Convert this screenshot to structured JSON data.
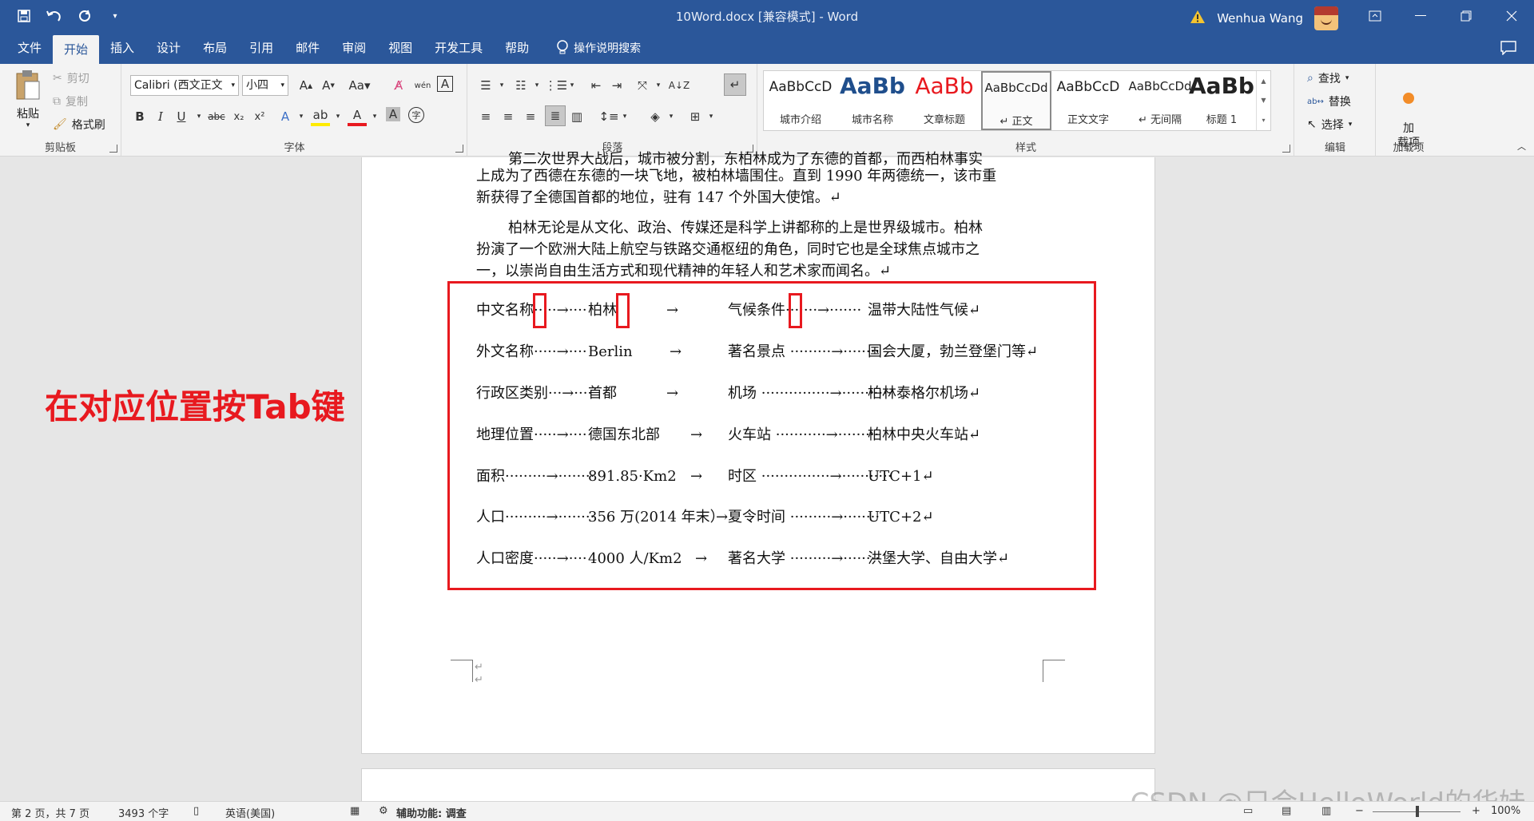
{
  "titlebar": {
    "title": "10Word.docx [兼容模式] - Word",
    "user": "Wenhua Wang"
  },
  "menu": {
    "items": [
      "文件",
      "开始",
      "插入",
      "设计",
      "布局",
      "引用",
      "邮件",
      "审阅",
      "视图",
      "开发工具",
      "帮助"
    ],
    "active": "开始",
    "tell_me": "操作说明搜索"
  },
  "ribbon": {
    "clipboard": {
      "paste": "粘贴",
      "cut": "剪切",
      "copy": "复制",
      "format_painter": "格式刷",
      "label": "剪贴板"
    },
    "font": {
      "font_name": "Calibri (西文正文",
      "font_size": "小四",
      "label": "字体"
    },
    "paragraph": {
      "label": "段落"
    },
    "styles": {
      "label": "样式",
      "items": [
        {
          "sample": "AaBbCcD",
          "name": "城市介绍"
        },
        {
          "sample": "AaBb",
          "name": "城市名称"
        },
        {
          "sample": "AaBb",
          "name": "文章标题"
        },
        {
          "sample": "AaBbCcDd",
          "name": "↵ 正文"
        },
        {
          "sample": "AaBbCcD",
          "name": "正文文字"
        },
        {
          "sample": "AaBbCcDd",
          "name": "↵ 无间隔"
        },
        {
          "sample": "AaBb",
          "name": "标题 1"
        }
      ]
    },
    "editing": {
      "find": "查找",
      "replace": "替换",
      "select": "选择",
      "label": "编辑"
    },
    "addins": {
      "button": "加\n载项",
      "label": "加载项"
    }
  },
  "document": {
    "para1_line1": "第二次世界大战后，城市被分割，东柏林成为了东德的首都，而西柏林事实",
    "para1_line2": "上成为了西德在东德的一块飞地，被柏林墙围住。直到 1990 年两德统一，该市重",
    "para1_line3": "新获得了全德国首都的地位，驻有 147 个外国大使馆。↵",
    "para2_line1": "柏林无论是从文化、政治、传媒还是科学上讲都称的上是世界级城市。柏林",
    "para2_line2": "扮演了一个欧洲大陆上航空与铁路交通枢纽的角色，同时它也是全球焦点城市之",
    "para2_line3": "一，以崇尚自由生活方式和现代精神的年轻人和艺术家而闻名。↵",
    "rows": [
      {
        "k1": "中文名称·····→····",
        "v1": "柏林",
        "a": "→",
        "k2": "气候条件·······→·······",
        "v2": "温带大陆性气候↵"
      },
      {
        "k1": "外文名称·····→····",
        "v1": "Berlin",
        "a": "→",
        "k2": "著名景点 ·········→········",
        "v2": "国会大厦，勃兰登堡门等↵"
      },
      {
        "k1": "行政区类别···→····",
        "v1": "首都",
        "a": "→",
        "k2": "机场 ···············→···········",
        "v2": "柏林泰格尔机场↵"
      },
      {
        "k1": "地理位置·····→····",
        "v1": "德国东北部",
        "a": "→",
        "k2": "火车站 ···········→·········",
        "v2": "柏林中央火车站↵"
      },
      {
        "k1": "面积·········→········",
        "v1": "891.85·Km2",
        "a": "→",
        "k2": "时区 ···············→···········",
        "v2": "UTC+1↵"
      },
      {
        "k1": "人口·········→········",
        "v1": "356 万(2014 年末）",
        "a": "→",
        "k2": "夏令时间 ·········→········",
        "v2": "UTC+2↵"
      },
      {
        "k1": "人口密度·····→····",
        "v1": "4000 人/Km2",
        "a": "→",
        "k2": "著名大学 ·········→········",
        "v2": "洪堡大学、自由大学↵"
      }
    ]
  },
  "annotation": "在对应位置按Tab键",
  "watermark": "CSDN @只会HelloWorld的华娃",
  "statusbar": {
    "page": "第 2 页，共 7 页",
    "words": "3493 个字",
    "language": "英语(美国)",
    "accessibility": "辅助功能: 调查",
    "zoom": "100%"
  },
  "colors": {
    "titlebar": "#2b579a",
    "ribbon": "#f3f3f3",
    "highlight_red": "#e8191f"
  }
}
